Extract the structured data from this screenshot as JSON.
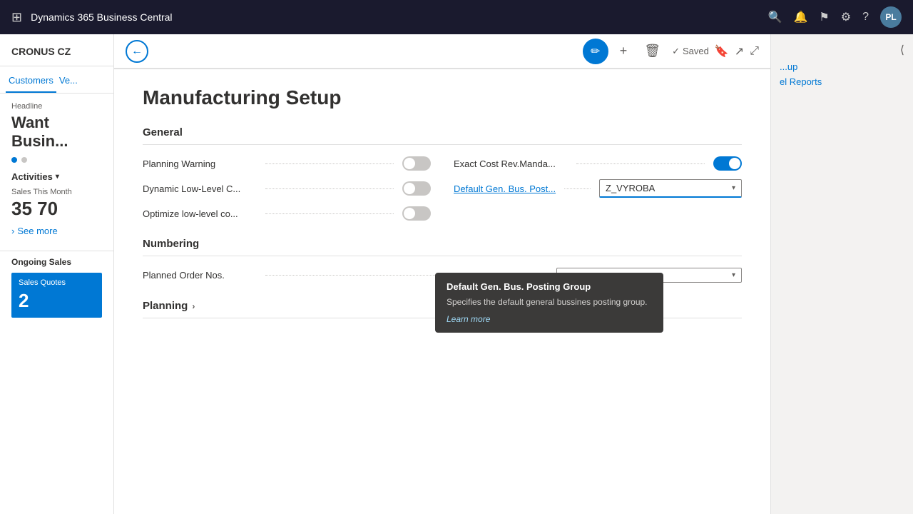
{
  "topbar": {
    "app_title": "Dynamics 365 Business Central",
    "avatar_initials": "PL"
  },
  "sidebar": {
    "company": "CRONUS CZ",
    "nav_items": [
      {
        "label": "Customers",
        "active": true
      },
      {
        "label": "Ve..."
      }
    ],
    "headline_label": "Headline",
    "headline_text_line1": "Want",
    "headline_text_line2": "Busin...",
    "activities_label": "Activities",
    "sales_this_month_label": "Sales This Month",
    "sales_value": "35 70",
    "see_more_label": "See more",
    "ongoing_sales_label": "Ongoing Sales",
    "sales_quotes_label": "Sales Quotes",
    "sales_quotes_value": "2"
  },
  "right_panel": {
    "items": [
      {
        "label": "...up"
      },
      {
        "label": "el Reports"
      }
    ]
  },
  "sub_nav": {
    "saved_label": "Saved"
  },
  "form": {
    "title": "Manufacturing Setup",
    "general_section": "General",
    "fields": {
      "planning_warning": "Planning Warning",
      "planning_warning_on": false,
      "exact_cost": "Exact Cost Rev.Manda...",
      "exact_cost_on": true,
      "dynamic_low_level": "Dynamic Low-Level C...",
      "dynamic_low_level_on": false,
      "default_gen_bus": "Default Gen. Bus. Post...",
      "default_gen_bus_value": "Z_VYROBA",
      "optimize_low_level": "Optimize low-level co...",
      "optimize_low_level_on": false
    },
    "numbering_section": "Numbering",
    "planned_order_nos_label": "Planned Order Nos.",
    "planning_section": "Planning",
    "tooltip": {
      "title": "Default Gen. Bus. Posting Group",
      "description": "Specifies the default general bussines posting group.",
      "link": "Learn more"
    }
  }
}
